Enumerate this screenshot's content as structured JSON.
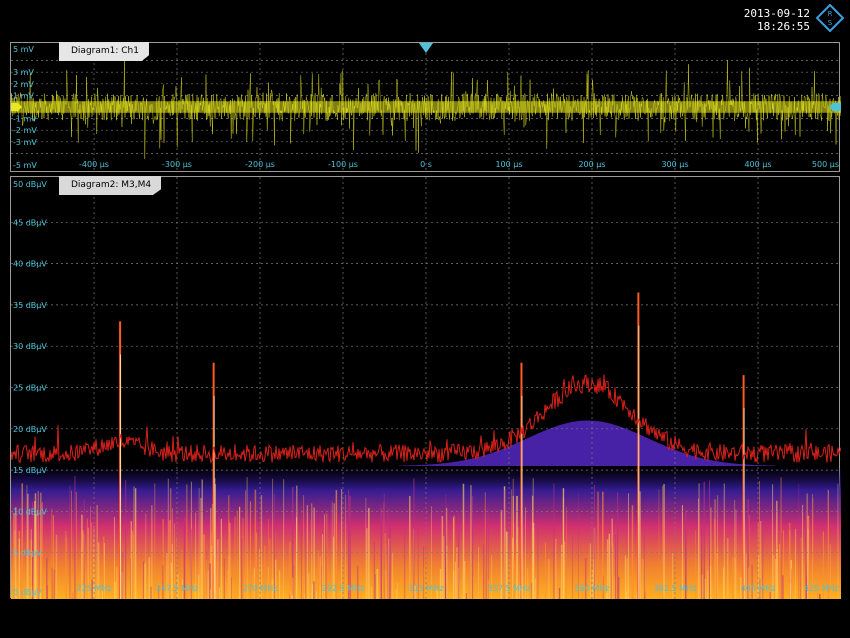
{
  "header": {
    "date": "2013-09-12",
    "time": "18:26:55",
    "logo_icon": "rohde-schwarz-logo-icon"
  },
  "colors": {
    "trace_yellow": "#e8e820",
    "trace_red": "#d8201a",
    "axis_text": "#4ec3d8",
    "grid": "#7a7a7a",
    "spectrogram_low": "#3a20a0",
    "spectrogram_mid": "#d03070",
    "spectrogram_high": "#ffb020"
  },
  "chart_data": [
    {
      "type": "line",
      "name": "time-domain",
      "tab_label": "Diagram1: Ch1",
      "x_ticks": [
        "-400 µs",
        "-300 µs",
        "-200 µs",
        "-100 µs",
        "0 s",
        "100 µs",
        "200 µs",
        "300 µs",
        "400 µs",
        "500 µs"
      ],
      "y_ticks": [
        "5 mV",
        "3 mV",
        "2 mV",
        "1 mV",
        "-1 mV",
        "-2 mV",
        "-3 mV",
        "-5 mV"
      ],
      "xlim": [
        -500,
        500
      ],
      "ylim": [
        -5,
        5
      ],
      "grid": true,
      "trigger_marker": "0 s",
      "series": [
        {
          "color": "#e8e820",
          "description": "noise centered at 0 mV, band approx ±1 mV, spikes to ±5 mV"
        }
      ]
    },
    {
      "type": "line",
      "name": "spectrum",
      "tab_label": "Diagram2: M3,M4",
      "x_ticks": [
        "225 MHz",
        "247.5 MHz",
        "270 MHz",
        "292.5 MHz",
        "315 MHz",
        "337.5 MHz",
        "360 MHz",
        "382.5 MHz",
        "405 MHz",
        "425 MHz"
      ],
      "y_ticks": [
        "50 dBµV",
        "45 dBµV",
        "40 dBµV",
        "35 dBµV",
        "30 dBµV",
        "25 dBµV",
        "20 dBµV",
        "15 dBµV",
        "10 dBµV",
        "5 dBµV",
        "0 dBµV"
      ],
      "xlim": [
        212,
        425
      ],
      "ylim": [
        0,
        50
      ],
      "grid": true,
      "noise_floor_dbuv": 17,
      "hump": {
        "center_mhz": 360,
        "peak_dbuv": 25.5,
        "width_mhz": 22
      },
      "spikes": [
        {
          "x": 240,
          "y": 33
        },
        {
          "x": 264,
          "y": 28
        },
        {
          "x": 343,
          "y": 28
        },
        {
          "x": 373,
          "y": 36.5
        },
        {
          "x": 400,
          "y": 26.5
        }
      ]
    }
  ]
}
